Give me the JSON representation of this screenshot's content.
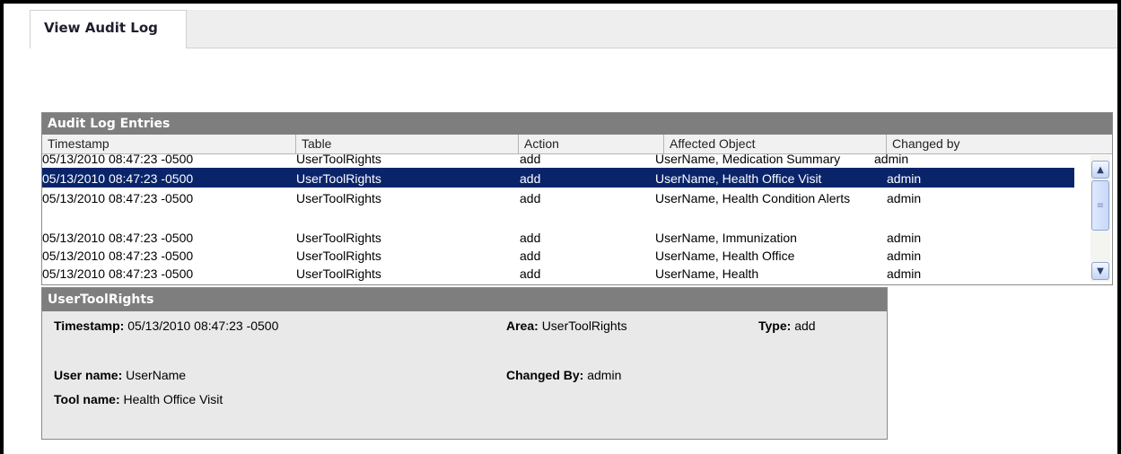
{
  "tabs": {
    "active_label": "View Audit Log"
  },
  "entries": {
    "title": "Audit Log Entries",
    "columns": [
      "Timestamp",
      "Table",
      "Action",
      "Affected Object",
      "Changed by"
    ],
    "rows": [
      {
        "timestamp": "05/13/2010 08:47:23 -0500",
        "table": "UserToolRights",
        "action": "add",
        "affected": "UserName, Medication Summary",
        "changed_by": "admin"
      },
      {
        "timestamp": "05/13/2010 08:47:23 -0500",
        "table": "UserToolRights",
        "action": "add",
        "affected": "UserName, Health Office Visit",
        "changed_by": "admin"
      },
      {
        "timestamp": "05/13/2010 08:47:23 -0500",
        "table": "UserToolRights",
        "action": "add",
        "affected": "UserName, Health Condition Alerts",
        "changed_by": "admin"
      },
      {
        "timestamp": "05/13/2010 08:47:23 -0500",
        "table": "UserToolRights",
        "action": "add",
        "affected": "UserName, Immunization",
        "changed_by": "admin"
      },
      {
        "timestamp": "05/13/2010 08:47:23 -0500",
        "table": "UserToolRights",
        "action": "add",
        "affected": "UserName, Health Office",
        "changed_by": "admin"
      },
      {
        "timestamp": "05/13/2010 08:47:23 -0500",
        "table": "UserToolRights",
        "action": "add",
        "affected": "UserName, Health",
        "changed_by": "admin"
      }
    ]
  },
  "detail": {
    "title": "UserToolRights",
    "timestamp_label": "Timestamp:",
    "timestamp": "05/13/2010 08:47:23 -0500",
    "area_label": "Area:",
    "area": "UserToolRights",
    "type_label": "Type:",
    "type": "add",
    "user_label": "User name:",
    "user": "UserName",
    "changed_label": "Changed By:",
    "changed": "admin",
    "tool_label": "Tool name:",
    "tool": "Health Office Visit"
  },
  "colors": {
    "selected_row": "#0a246a",
    "panel_header": "#7e7e7e",
    "detail_bg": "#e9e9e9"
  },
  "icons": {
    "scroll_up": "scroll-up-icon",
    "scroll_down": "scroll-down-icon",
    "grip": "scroll-grip-icon"
  }
}
